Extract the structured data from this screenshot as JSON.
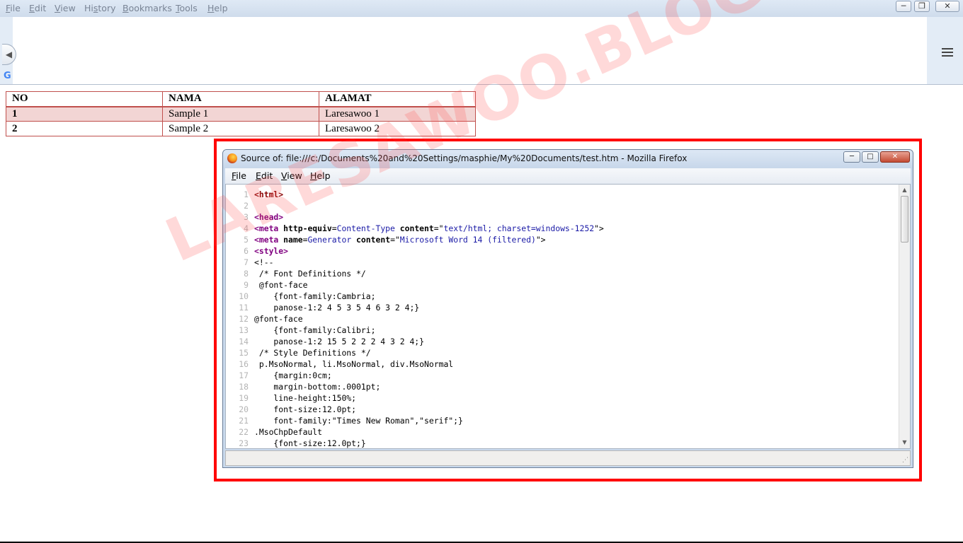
{
  "browser": {
    "menu": [
      {
        "pre": "",
        "u": "F",
        "post": "ile"
      },
      {
        "pre": "",
        "u": "E",
        "post": "dit"
      },
      {
        "pre": "",
        "u": "V",
        "post": "iew"
      },
      {
        "pre": "Hi",
        "u": "s",
        "post": "tory"
      },
      {
        "pre": "",
        "u": "B",
        "post": "ookmarks"
      },
      {
        "pre": "",
        "u": "T",
        "post": "ools"
      },
      {
        "pre": "",
        "u": "H",
        "post": "elp"
      }
    ],
    "window_controls": {
      "minimize": "─",
      "restore": "❐",
      "close": "✕"
    },
    "back_icon": "◀",
    "google_glyph": "G"
  },
  "table": {
    "headers": [
      "NO",
      "NAMA",
      "ALAMAT"
    ],
    "rows": [
      [
        "1",
        "Sample 1",
        "Laresawoo 1"
      ],
      [
        "2",
        "Sample 2",
        "Laresawoo 2"
      ]
    ]
  },
  "source_window": {
    "title": "Source of: file:///c:/Documents%20and%20Settings/masphie/My%20Documents/test.htm - Mozilla Firefox",
    "controls": {
      "minimize": "─",
      "restore": "□",
      "close": "✕"
    },
    "menu": [
      {
        "pre": "",
        "u": "F",
        "post": "ile"
      },
      {
        "pre": "",
        "u": "E",
        "post": "dit"
      },
      {
        "pre": "",
        "u": "V",
        "post": "iew"
      },
      {
        "pre": "",
        "u": "H",
        "post": "elp"
      }
    ],
    "lines": [
      {
        "n": "1",
        "parts": [
          [
            "tag",
            "<html>"
          ]
        ]
      },
      {
        "n": "2",
        "parts": []
      },
      {
        "n": "3",
        "parts": [
          [
            "tag2",
            "<head>"
          ]
        ]
      },
      {
        "n": "4",
        "parts": [
          [
            "tag2",
            "<meta"
          ],
          [
            "tx",
            " "
          ],
          [
            "attr",
            "http-equiv"
          ],
          [
            "tx",
            "="
          ],
          [
            "val",
            "Content-Type"
          ],
          [
            "tx",
            " "
          ],
          [
            "attr",
            "content"
          ],
          [
            "tx",
            "=\""
          ],
          [
            "val",
            "text/html; charset=windows-1252"
          ],
          [
            "tx",
            "\">"
          ]
        ]
      },
      {
        "n": "5",
        "parts": [
          [
            "tag2",
            "<meta"
          ],
          [
            "tx",
            " "
          ],
          [
            "attr",
            "name"
          ],
          [
            "tx",
            "="
          ],
          [
            "val",
            "Generator"
          ],
          [
            "tx",
            " "
          ],
          [
            "attr",
            "content"
          ],
          [
            "tx",
            "=\""
          ],
          [
            "val",
            "Microsoft Word 14 (filtered)"
          ],
          [
            "tx",
            "\">"
          ]
        ]
      },
      {
        "n": "6",
        "parts": [
          [
            "tag2",
            "<style>"
          ]
        ]
      },
      {
        "n": "7",
        "parts": [
          [
            "tx",
            "<!--"
          ]
        ]
      },
      {
        "n": "8",
        "parts": [
          [
            "tx",
            " /* Font Definitions */"
          ]
        ]
      },
      {
        "n": "9",
        "parts": [
          [
            "tx",
            " @font-face"
          ]
        ]
      },
      {
        "n": "10",
        "parts": [
          [
            "tx",
            "    {font-family:Cambria;"
          ]
        ]
      },
      {
        "n": "11",
        "parts": [
          [
            "tx",
            "    panose-1:2 4 5 3 5 4 6 3 2 4;}"
          ]
        ]
      },
      {
        "n": "12",
        "parts": [
          [
            "tx",
            "@font-face"
          ]
        ]
      },
      {
        "n": "13",
        "parts": [
          [
            "tx",
            "    {font-family:Calibri;"
          ]
        ]
      },
      {
        "n": "14",
        "parts": [
          [
            "tx",
            "    panose-1:2 15 5 2 2 2 4 3 2 4;}"
          ]
        ]
      },
      {
        "n": "15",
        "parts": [
          [
            "tx",
            " /* Style Definitions */"
          ]
        ]
      },
      {
        "n": "16",
        "parts": [
          [
            "tx",
            " p.MsoNormal, li.MsoNormal, div.MsoNormal"
          ]
        ]
      },
      {
        "n": "17",
        "parts": [
          [
            "tx",
            "    {margin:0cm;"
          ]
        ]
      },
      {
        "n": "18",
        "parts": [
          [
            "tx",
            "    margin-bottom:.0001pt;"
          ]
        ]
      },
      {
        "n": "19",
        "parts": [
          [
            "tx",
            "    line-height:150%;"
          ]
        ]
      },
      {
        "n": "20",
        "parts": [
          [
            "tx",
            "    font-size:12.0pt;"
          ]
        ]
      },
      {
        "n": "21",
        "parts": [
          [
            "tx",
            "    font-family:\"Times New Roman\",\"serif\";}"
          ]
        ]
      },
      {
        "n": "22",
        "parts": [
          [
            "tx",
            ".MsoChpDefault"
          ]
        ]
      },
      {
        "n": "23",
        "parts": [
          [
            "tx",
            "    {font-size:12.0pt;}"
          ]
        ]
      }
    ],
    "scroll_up": "▲",
    "scroll_down": "▼",
    "scroll_grip": "≡",
    "resize_grip": "⋰"
  },
  "watermark": "LARESAWOO.BLOGSPOT.CO.ID",
  "colors": {
    "highlight": "#ff0000",
    "table_border": "#c0504d",
    "table_shade": "#f2d5d4"
  }
}
